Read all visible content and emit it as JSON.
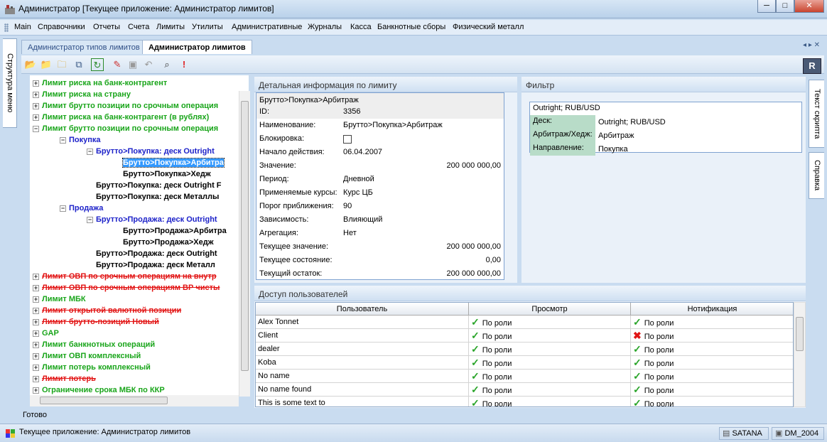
{
  "window": {
    "title": "Администратор [Текущее приложение: Администратор лимитов]",
    "min": "─",
    "max": "□",
    "close": "✕"
  },
  "menu": [
    "Main",
    "Справочники",
    "Отчеты",
    "Счета",
    "Лимиты",
    "Утилиты",
    "Административные",
    "Журналы",
    "Касса",
    "Банкнотные сборы",
    "Физический металл"
  ],
  "left_strip": "Структура меню",
  "tabs": [
    "Администратор типов лимитов",
    "Администратор лимитов"
  ],
  "tab_nav": "◂ ▸ ✕",
  "tree": [
    {
      "pm": "+",
      "label": "Лимит риска на банк-контрагент",
      "color": "green",
      "level": 0
    },
    {
      "pm": "+",
      "label": "Лимит риска на страну",
      "color": "green",
      "level": 0
    },
    {
      "pm": "+",
      "label": "Лимит брутто позиции по срочным операция",
      "color": "green",
      "level": 0
    },
    {
      "pm": "+",
      "label": "Лимит риска на банк-контрагент (в рублях)",
      "color": "green",
      "level": 0
    },
    {
      "pm": "−",
      "label": "Лимит брутто позиции по срочным операция",
      "color": "green",
      "level": 0
    },
    {
      "pm": "−",
      "label": "Покупка",
      "color": "blue",
      "level": 1
    },
    {
      "pm": "−",
      "label": "Брутто>Покупка: деск Outright",
      "color": "blue",
      "level": 2
    },
    {
      "pm": "",
      "label": "Брутто>Покупка>Арбитра",
      "color": "sel",
      "level": 3
    },
    {
      "pm": "",
      "label": "Брутто>Покупка>Хедж",
      "color": "black",
      "level": 3
    },
    {
      "pm": "",
      "label": "Брутто>Покупка: деск Outright F",
      "color": "black",
      "level": 2
    },
    {
      "pm": "",
      "label": "Брутто>Покупка: деск Металлы",
      "color": "black",
      "level": 2
    },
    {
      "pm": "−",
      "label": "Продажа",
      "color": "blue",
      "level": 1
    },
    {
      "pm": "−",
      "label": "Брутто>Продажа: деск Outright",
      "color": "blue",
      "level": 2
    },
    {
      "pm": "",
      "label": "Брутто>Продажа>Арбитра",
      "color": "black",
      "level": 3
    },
    {
      "pm": "",
      "label": "Брутто>Продажа>Хедж",
      "color": "black",
      "level": 3
    },
    {
      "pm": "",
      "label": "Брутто>Продажа: деск Outright",
      "color": "black",
      "level": 2
    },
    {
      "pm": "",
      "label": "Брутто>Продажа: деск Металл",
      "color": "black",
      "level": 2
    },
    {
      "pm": "+",
      "label": "Лимит ОВП по срочным операциям на внутр",
      "color": "red",
      "level": 0
    },
    {
      "pm": "+",
      "label": "Лимит ОВП по срочным операциям ВР чисты",
      "color": "red",
      "level": 0
    },
    {
      "pm": "+",
      "label": "Лимит МБК",
      "color": "green",
      "level": 0
    },
    {
      "pm": "+",
      "label": "Лимит открытой валютной позиции",
      "color": "red",
      "level": 0
    },
    {
      "pm": "+",
      "label": "Лимит брутто-позиций Новый",
      "color": "red",
      "level": 0
    },
    {
      "pm": "+",
      "label": "GAP",
      "color": "green",
      "level": 0
    },
    {
      "pm": "+",
      "label": "Лимит банкнотных операций",
      "color": "green",
      "level": 0
    },
    {
      "pm": "+",
      "label": "Лимит ОВП комплексный",
      "color": "green",
      "level": 0
    },
    {
      "pm": "+",
      "label": "Лимит потерь комплексный",
      "color": "green",
      "level": 0
    },
    {
      "pm": "+",
      "label": "Лимит потерь",
      "color": "red",
      "level": 0
    },
    {
      "pm": "+",
      "label": "Ограничение срока МБК по ККР",
      "color": "green",
      "level": 0
    },
    {
      "pm": "+",
      "label": "",
      "color": "black",
      "level": 0
    }
  ],
  "details": {
    "header": "Детальная информация по лимиту",
    "path": "Брутто>Покупка>Арбитраж",
    "rows": [
      {
        "label": "ID:",
        "value": "3356",
        "align": "left"
      },
      {
        "label": "Наименование:",
        "value": "Брутто>Покупка>Арбитраж",
        "align": "left"
      },
      {
        "label": "Блокировка:",
        "value": "",
        "align": "checkbox"
      },
      {
        "label": "Начало действия:",
        "value": "06.04.2007",
        "align": "left"
      },
      {
        "label": "Значение:",
        "value": "200 000 000,00",
        "align": "right"
      },
      {
        "label": "Период:",
        "value": "Дневной",
        "align": "left"
      },
      {
        "label": "Применяемые курсы:",
        "value": "Курс ЦБ",
        "align": "left"
      },
      {
        "label": "Порог приближения:",
        "value": "90",
        "align": "left"
      },
      {
        "label": "Зависимость:",
        "value": "Влияющий",
        "align": "left"
      },
      {
        "label": "Агрегация:",
        "value": "Нет",
        "align": "left"
      },
      {
        "label": "Текущее значение:",
        "value": "200 000 000,00",
        "align": "right"
      },
      {
        "label": "Текущее состояние:",
        "value": "0,00",
        "align": "right"
      },
      {
        "label": "Текущий остаток:",
        "value": "200 000 000,00",
        "align": "right"
      }
    ]
  },
  "filter": {
    "header": "Фильтр",
    "title": "Outright; RUB/USD",
    "rows": [
      {
        "label": "Деск:",
        "value": "Outright; RUB/USD"
      },
      {
        "label": "Арбитраж/Хедж:",
        "value": "Арбитраж"
      },
      {
        "label": "Направление:",
        "value": "Покупка"
      }
    ]
  },
  "access": {
    "header": "Доступ пользователей",
    "columns": [
      "Пользователь",
      "Просмотр",
      "Нотификация"
    ],
    "rows": [
      {
        "user": "Alex Tonnet",
        "view": "По роли",
        "notify": "По роли",
        "notify_ok": true
      },
      {
        "user": "Client",
        "view": "По роли",
        "notify": "По роли",
        "notify_ok": false
      },
      {
        "user": "dealer",
        "view": "По роли",
        "notify": "По роли",
        "notify_ok": true
      },
      {
        "user": "Koba",
        "view": "По роли",
        "notify": "По роли",
        "notify_ok": true
      },
      {
        "user": "No name",
        "view": "По роли",
        "notify": "По роли",
        "notify_ok": true
      },
      {
        "user": "No name found",
        "view": "По роли",
        "notify": "По роли",
        "notify_ok": true
      },
      {
        "user": "This is some text to",
        "view": "По роли",
        "notify": "По роли",
        "notify_ok": true
      }
    ]
  },
  "right_tabs": [
    "Текст скрипта",
    "Справка"
  ],
  "status": {
    "ready": "Готово",
    "app": "Текущее приложение: Администратор лимитов",
    "server": "SATANA",
    "db": "DM_2004"
  },
  "colors": {
    "green": "#19a51a",
    "red": "#e21414",
    "blue": "#1d22c9",
    "selection": "#3399ff"
  }
}
